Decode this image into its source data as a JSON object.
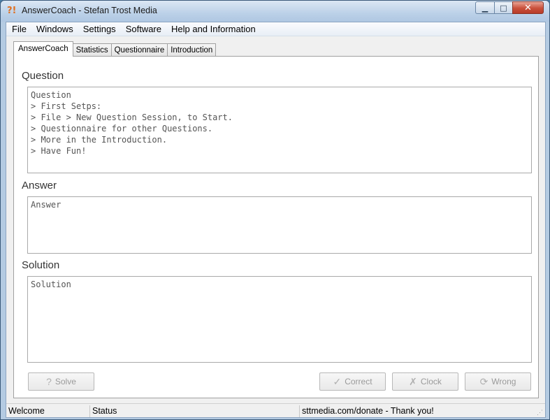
{
  "window": {
    "title": "AnswerCoach - Stefan Trost Media",
    "app_icon_glyph": "?!",
    "minimize_glyph": "▁",
    "maximize_glyph": "□",
    "close_glyph": "✕"
  },
  "menu": [
    "File",
    "Windows",
    "Settings",
    "Software",
    "Help and Information"
  ],
  "tabs": [
    "AnswerCoach",
    "Statistics",
    "Questionnaire",
    "Introduction"
  ],
  "active_tab": "AnswerCoach",
  "question": {
    "label": "Question",
    "text": "Question\n> First Setps:\n> File > New Question Session, to Start.\n> Questionnaire for other Questions.\n> More in the Introduction.\n> Have Fun!"
  },
  "answer": {
    "label": "Answer",
    "text": "Answer"
  },
  "solution": {
    "label": "Solution",
    "text": "Solution"
  },
  "buttons": {
    "solve": {
      "label": "Solve",
      "icon": "question-icon",
      "glyph": "?"
    },
    "correct": {
      "label": "Correct",
      "icon": "checkmark-icon",
      "glyph": "✓"
    },
    "clock": {
      "label": "Clock",
      "icon": "cross-icon",
      "glyph": "✗"
    },
    "wrong": {
      "label": "Wrong",
      "icon": "refresh-icon",
      "glyph": "⟳"
    }
  },
  "status": {
    "left": "Welcome",
    "middle": "Status",
    "right": "sttmedia.com/donate - Thank you!"
  },
  "colors": {
    "title_bar": "#bcd1e8",
    "close_button": "#c9503b",
    "app_icon": "#e07020"
  }
}
